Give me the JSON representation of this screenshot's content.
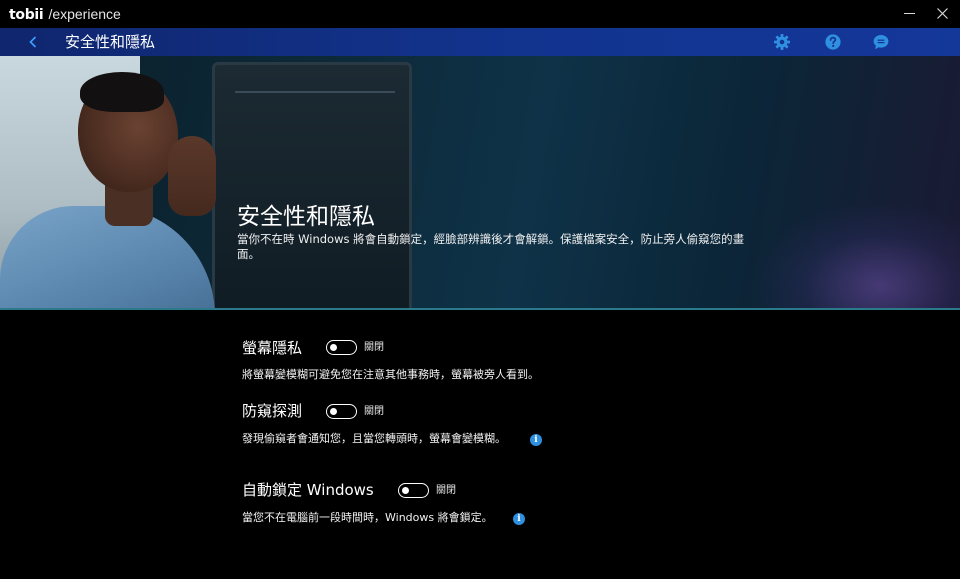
{
  "titlebar": {
    "brand": "tobii",
    "app_name": "/experience",
    "minimize_icon": "minimize-icon",
    "close_icon": "close-icon"
  },
  "header": {
    "back_icon": "chevron-left-icon",
    "title": "安全性和隱私",
    "icons": [
      "gear-icon",
      "help-icon",
      "chat-icon"
    ],
    "accent_color": "#12348f",
    "icon_color": "#2f8fe0"
  },
  "hero": {
    "title": "安全性和隱私",
    "description": "當你不在時 Windows 將會自動鎖定，經臉部辨識後才會解鎖。保護檔案安全，防止旁人偷窺您的畫面。"
  },
  "settings": [
    {
      "title": "螢幕隱私",
      "toggle_state": "關閉",
      "description": "將螢幕變模糊可避免您在注意其他事務時，螢幕被旁人看到。"
    },
    {
      "title": "防窺探測",
      "toggle_state": "關閉",
      "description": "發現偷窺者會通知您，且當您轉頭時，螢幕會變模糊。",
      "info_icon": "info-icon"
    },
    {
      "title": "自動鎖定 Windows",
      "toggle_state": "關閉",
      "description": "當您不在電腦前一段時間時，Windows 將會鎖定。",
      "info_icon": "info-icon"
    }
  ]
}
